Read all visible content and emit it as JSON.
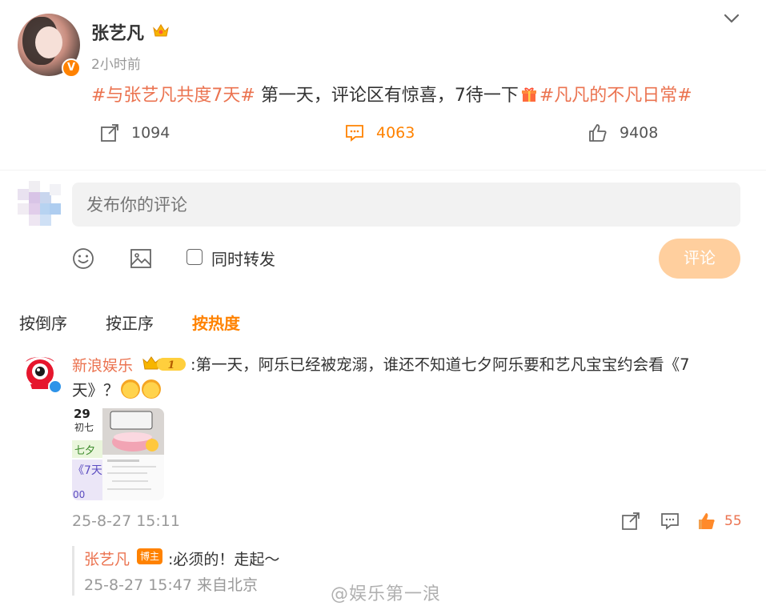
{
  "post": {
    "author": "张艺凡",
    "time": "2小时前",
    "verified_mark": "V",
    "content": {
      "tag1": "#与张艺凡共度7天#",
      "text_a": " 第一天，评论区有惊喜，7待一下",
      "tag2": "#凡凡的不凡日常#"
    },
    "actions": {
      "repost_count": "1094",
      "comment_count": "4063",
      "like_count": "9408"
    }
  },
  "composer": {
    "placeholder": "发布你的评论",
    "repost_label": "同时转发",
    "submit_label": "评论"
  },
  "sort_tabs": [
    "按倒序",
    "按正序",
    "按热度"
  ],
  "comment": {
    "author": "新浪娱乐",
    "level": "1",
    "text": ":第一天，阿乐已经被宠溺，谁还不知道七夕阿乐要和艺凡宝宝约会看《7天》？",
    "thumb": {
      "date_num": "29",
      "lunar": "初七",
      "qixi": "七夕",
      "movie": "《7天",
      "num": "00"
    },
    "time": "25-8-27 15:11",
    "likes": "55",
    "reply": {
      "author": "张艺凡",
      "badge": "博主",
      "text": ":必须的！走起～",
      "time": "25-8-27 15:47 来自北京"
    }
  },
  "watermark": "@娱乐第一浪",
  "colors": {
    "accent": "#ff8200",
    "tag": "#eb7350",
    "submit_disabled": "#ffcf9e",
    "muted": "#999999"
  }
}
